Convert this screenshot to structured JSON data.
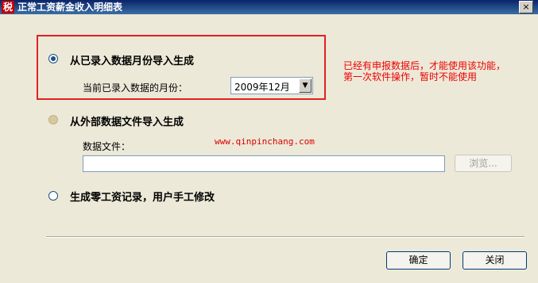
{
  "window": {
    "title": "正常工资薪金收入明细表",
    "close": "×",
    "icon_char": "税"
  },
  "options": [
    {
      "label": "从已录入数据月份导入生成",
      "selected": true,
      "enabled": true
    },
    {
      "label": "从外部数据文件导入生成",
      "selected": false,
      "enabled": false
    },
    {
      "label": "生成零工资记录，用户手工修改",
      "selected": false,
      "enabled": true
    }
  ],
  "month": {
    "label": "当前已录入数据的月份：",
    "value": "2009年12月"
  },
  "note": {
    "line1": "已经有申报数据后，才能使用该功能，",
    "line2": "第一次软件操作，暂时不能使用"
  },
  "watermark": "www.qinpinchang.com",
  "file": {
    "label": "数据文件：",
    "value": "",
    "browse_label": "浏览..."
  },
  "buttons": {
    "ok": "确定",
    "close": "关闭"
  },
  "colors": {
    "accent": "#1c5180",
    "annotation": "#dd2222"
  }
}
